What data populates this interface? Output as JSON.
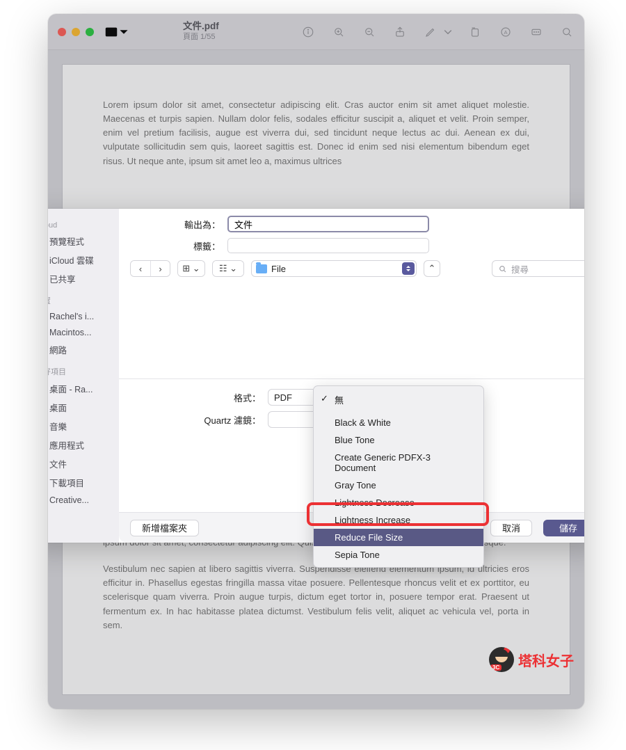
{
  "window": {
    "title": "文件.pdf",
    "subtitle": "頁面 1/55"
  },
  "document": {
    "para1": "Lorem ipsum dolor sit amet, consectetur adipiscing elit. Cras auctor enim sit amet aliquet molestie. Maecenas et turpis sapien. Nullam dolor felis, sodales efficitur suscipit a, aliquet et velit. Proin semper, enim vel pretium facilisis, augue est viverra dui, sed tincidunt neque lectus ac dui. Aenean ex dui, vulputate sollicitudin sem quis, laoreet sagittis est. Donec id enim sed nisi elementum bibendum eget risus. Ut neque ante, ipsum sit amet leo a, maximus ultrices",
    "para2": "aliquet. Lorem ipsum dolor sit amet, consectetur adipiscing elit. Lorem ipsum dolor sit amet, consectetur adipiscing elit. Lorem ipsum dolor sit amet, volutpat arcu mollis vel. Sed nec urna sodales arcu. Lorem ipsum dolor sit amet, consectetur adipiscing elit. Quisque in libero ut turpis ullamcorper pellentesque.",
    "para3": "Vestibulum nec sapien at libero sagittis viverra. Suspendisse eleifend elementum ipsum, id ultricies eros efficitur in. Phasellus egestas fringilla massa vitae posuere. Pellentesque rhoncus velit et ex porttitor, eu scelerisque quam viverra. Proin augue turpis, dictum eget tortor in, posuere tempor erat. Praesent ut fermentum ex. In hac habitasse platea dictumst. Vestibulum felis velit, aliquet ac vehicula vel, porta in sem."
  },
  "sidebar": {
    "section1": "iCloud",
    "items1": [
      {
        "label": "預覽程式"
      },
      {
        "label": "iCloud 雲碟"
      },
      {
        "label": "已共享"
      }
    ],
    "section2": "位置",
    "items2": [
      {
        "label": "Rachel's i..."
      },
      {
        "label": "Macintos..."
      },
      {
        "label": "網路"
      }
    ],
    "section3": "喜好項目",
    "items3": [
      {
        "label": "桌面 - Ra..."
      },
      {
        "label": "桌面"
      },
      {
        "label": "音樂"
      },
      {
        "label": "應用程式"
      },
      {
        "label": "文件"
      },
      {
        "label": "下載項目"
      },
      {
        "label": "Creative..."
      }
    ]
  },
  "sheet": {
    "exportAsLabel": "輸出為：",
    "exportAsValue": "文件",
    "tagsLabel": "標籤：",
    "folderName": "File",
    "searchPlaceholder": "搜尋",
    "formatLabel": "格式：",
    "formatValue": "PDF",
    "quartzLabel": "Quartz 濾鏡：",
    "newFolder": "新增檔案夾",
    "cancel": "取消",
    "save": "儲存"
  },
  "quartzMenu": {
    "none": "無",
    "bw": "Black & White",
    "blue": "Blue Tone",
    "pdfx": "Create Generic PDFX-3 Document",
    "gray": "Gray Tone",
    "lightdec": "Lightness Decrease",
    "lightinc": "Lightness Increase",
    "reduce": "Reduce File Size",
    "sepia": "Sepia Tone"
  },
  "watermark": "塔科女子"
}
